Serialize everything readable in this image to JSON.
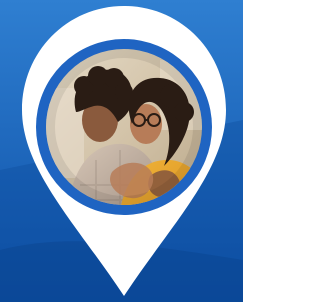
{
  "colors": {
    "background_top": "#2f7fd1",
    "background_bottom": "#0d4fa6",
    "pin_fill": "#ffffff",
    "ring": "#1f64c2",
    "photo_wall": "#cfc3ae",
    "hair": "#2a1c14",
    "skin_left": "#8a5a3d",
    "skin_right": "#b77c58",
    "shirt_left": "#c9b8a8",
    "sweater_right": "#e1a128"
  },
  "icons": {
    "pin": "map-pin-icon",
    "photo": "people-hugging-photo"
  }
}
